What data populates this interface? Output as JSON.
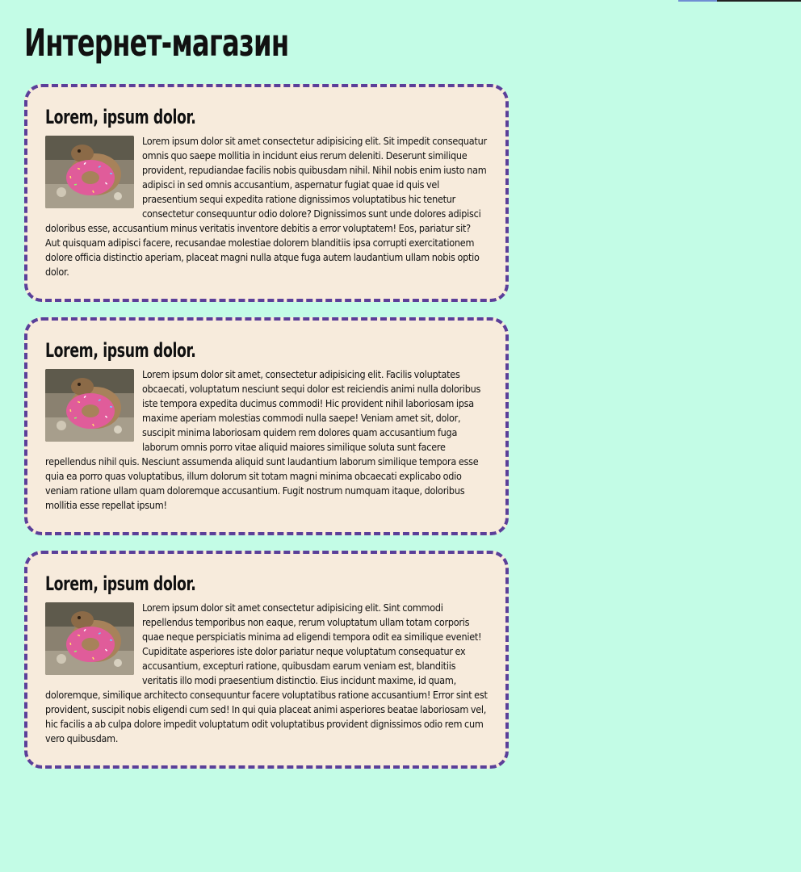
{
  "header": {
    "title": "Интернет-магазин"
  },
  "cards": [
    {
      "title": "Lorem, ipsum dolor.",
      "image_alt": "capybara-donut",
      "text": "Lorem ipsum dolor sit amet consectetur adipisicing elit. Sit impedit consequatur omnis quo saepe mollitia in incidunt eius rerum deleniti. Deserunt similique provident, repudiandae facilis nobis quibusdam nihil. Nihil nobis enim iusto nam adipisci in sed omnis accusantium, aspernatur fugiat quae id quis vel praesentium sequi expedita ratione dignissimos voluptatibus hic tenetur consectetur consequuntur odio dolore? Dignissimos sunt unde dolores adipisci doloribus esse, accusantium minus veritatis inventore debitis a error voluptatem! Eos, pariatur sit? Aut quisquam adipisci facere, recusandae molestiae dolorem blanditiis ipsa corrupti exercitationem dolore officia distinctio aperiam, placeat magni nulla atque fuga autem laudantium ullam nobis optio dolor."
    },
    {
      "title": "Lorem, ipsum dolor.",
      "image_alt": "capybara-donut",
      "text": "Lorem ipsum dolor sit amet, consectetur adipisicing elit. Facilis voluptates obcaecati, voluptatum nesciunt sequi dolor est reiciendis animi nulla doloribus iste tempora expedita ducimus commodi! Hic provident nihil laboriosam ipsa maxime aperiam molestias commodi nulla saepe! Veniam amet sit, dolor, suscipit minima laboriosam quidem rem dolores quam accusantium fuga laborum omnis porro vitae aliquid maiores similique soluta sunt facere repellendus nihil quis. Nesciunt assumenda aliquid sunt laudantium laborum similique tempora esse quia ea porro quas voluptatibus, illum dolorum sit totam magni minima obcaecati explicabo odio veniam ratione ullam quam doloremque accusantium. Fugit nostrum numquam itaque, doloribus mollitia esse repellat ipsum!"
    },
    {
      "title": "Lorem, ipsum dolor.",
      "image_alt": "capybara-donut",
      "text": "Lorem ipsum dolor sit amet consectetur adipisicing elit. Sint commodi repellendus temporibus non eaque, rerum voluptatum ullam totam corporis quae neque perspiciatis minima ad eligendi tempora odit ea similique eveniet! Cupiditate asperiores iste dolor pariatur neque voluptatum consequatur ex accusantium, excepturi ratione, quibusdam earum veniam est, blanditiis veritatis illo modi praesentium distinctio. Eius incidunt maxime, id quam, doloremque, similique architecto consequuntur facere voluptatibus ratione accusantium! Error sint est provident, suscipit nobis eligendi cum sed! In qui quia placeat animi asperiores beatae laboriosam vel, hic facilis a ab culpa dolore impedit voluptatum odit voluptatibus provident dignissimos odio rem cum vero quibusdam."
    }
  ],
  "colors": {
    "background": "#c3fce6",
    "card_background": "#f7ebdc",
    "card_border": "#5b3f99"
  }
}
